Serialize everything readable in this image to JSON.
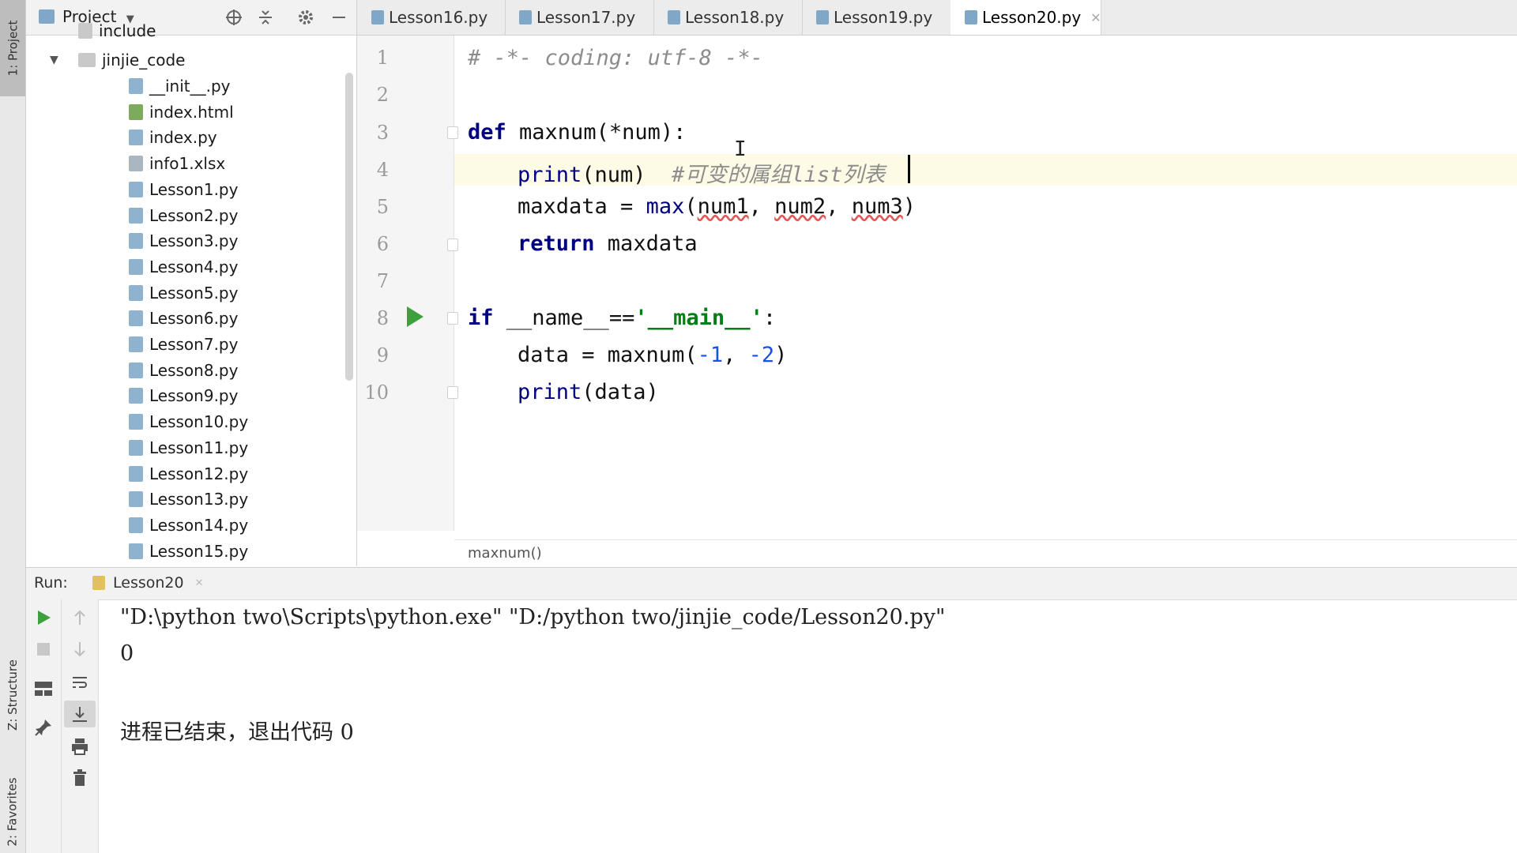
{
  "left_strip": {
    "project_tab": "1: Project",
    "structure_tab": "Z: Structure",
    "favorites_tab": "2: Favorites"
  },
  "project": {
    "title": "Project",
    "tree": [
      {
        "label": "include",
        "kind": "folder"
      },
      {
        "label": "jinjie_code",
        "kind": "folder"
      },
      {
        "label": "__init__.py",
        "kind": "py"
      },
      {
        "label": "index.html",
        "kind": "html"
      },
      {
        "label": "index.py",
        "kind": "py"
      },
      {
        "label": "info1.xlsx",
        "kind": "file"
      },
      {
        "label": "Lesson1.py",
        "kind": "py"
      },
      {
        "label": "Lesson2.py",
        "kind": "py"
      },
      {
        "label": "Lesson3.py",
        "kind": "py"
      },
      {
        "label": "Lesson4.py",
        "kind": "py"
      },
      {
        "label": "Lesson5.py",
        "kind": "py"
      },
      {
        "label": "Lesson6.py",
        "kind": "py"
      },
      {
        "label": "Lesson7.py",
        "kind": "py"
      },
      {
        "label": "Lesson8.py",
        "kind": "py"
      },
      {
        "label": "Lesson9.py",
        "kind": "py"
      },
      {
        "label": "Lesson10.py",
        "kind": "py"
      },
      {
        "label": "Lesson11.py",
        "kind": "py"
      },
      {
        "label": "Lesson12.py",
        "kind": "py"
      },
      {
        "label": "Lesson13.py",
        "kind": "py"
      },
      {
        "label": "Lesson14.py",
        "kind": "py"
      },
      {
        "label": "Lesson15.py",
        "kind": "py"
      }
    ]
  },
  "tabs": [
    {
      "label": "Lesson16.py"
    },
    {
      "label": "Lesson17.py"
    },
    {
      "label": "Lesson18.py"
    },
    {
      "label": "Lesson19.py"
    },
    {
      "label": "Lesson20.py",
      "active": true
    }
  ],
  "editor": {
    "line_numbers": [
      "1",
      "2",
      "3",
      "4",
      "5",
      "6",
      "7",
      "8",
      "9",
      "10"
    ],
    "lines": {
      "l1": "# -*- coding: utf-8 -*-",
      "l3_kw": "def",
      "l3_rest": " maxnum(*num):",
      "l4_fn": "print",
      "l4_rest": "(num)  ",
      "l4_comment": "#可变的属组list列表",
      "l5_a": "maxdata = ",
      "l5_fn": "max",
      "l5_open": "(",
      "l5_n1": "num1",
      "l5_c1": ", ",
      "l5_n2": "num2",
      "l5_c2": ", ",
      "l5_n3": "num3",
      "l5_close": ")",
      "l6_kw": "return",
      "l6_rest": " maxdata",
      "l8_kw": "if",
      "l8_a": " __name__==",
      "l8_str": "'__main__'",
      "l8_b": ":",
      "l9_a": "data = maxnum(",
      "l9_n1": "-1",
      "l9_c": ", ",
      "l9_n2": "-2",
      "l9_b": ")",
      "l10_fn": "print",
      "l10_rest": "(data)"
    },
    "breadcrumb": "maxnum()"
  },
  "run": {
    "label": "Run:",
    "tab": "Lesson20",
    "output": [
      "\"D:\\python two\\Scripts\\python.exe\" \"D:/python two/jinjie_code/Lesson20.py\"",
      "0",
      "",
      "进程已结束，退出代码 0"
    ]
  },
  "colors": {
    "keyword": "#000080",
    "string": "#067d17",
    "number": "#1750eb",
    "comment": "#8c8c8c",
    "run_green": "#3ca03c",
    "current_line": "#fdfbe6"
  }
}
